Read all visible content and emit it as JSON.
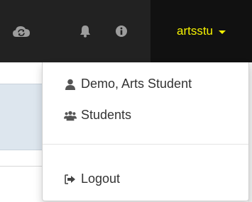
{
  "navbar": {
    "icons": [
      "cloud-sync-icon",
      "bell-icon",
      "info-icon"
    ],
    "user": {
      "username": "artsstu"
    }
  },
  "dropdown": {
    "items": [
      {
        "label": "Demo, Arts Student",
        "icon": "user-icon"
      },
      {
        "label": "Students",
        "icon": "users-icon"
      }
    ],
    "logout": {
      "label": "Logout",
      "icon": "sign-out-icon"
    }
  },
  "colors": {
    "navbar_bg": "#222222",
    "toggle_bg": "#111111",
    "username_color": "#f7f300",
    "icon_color": "#9d9d9d"
  }
}
